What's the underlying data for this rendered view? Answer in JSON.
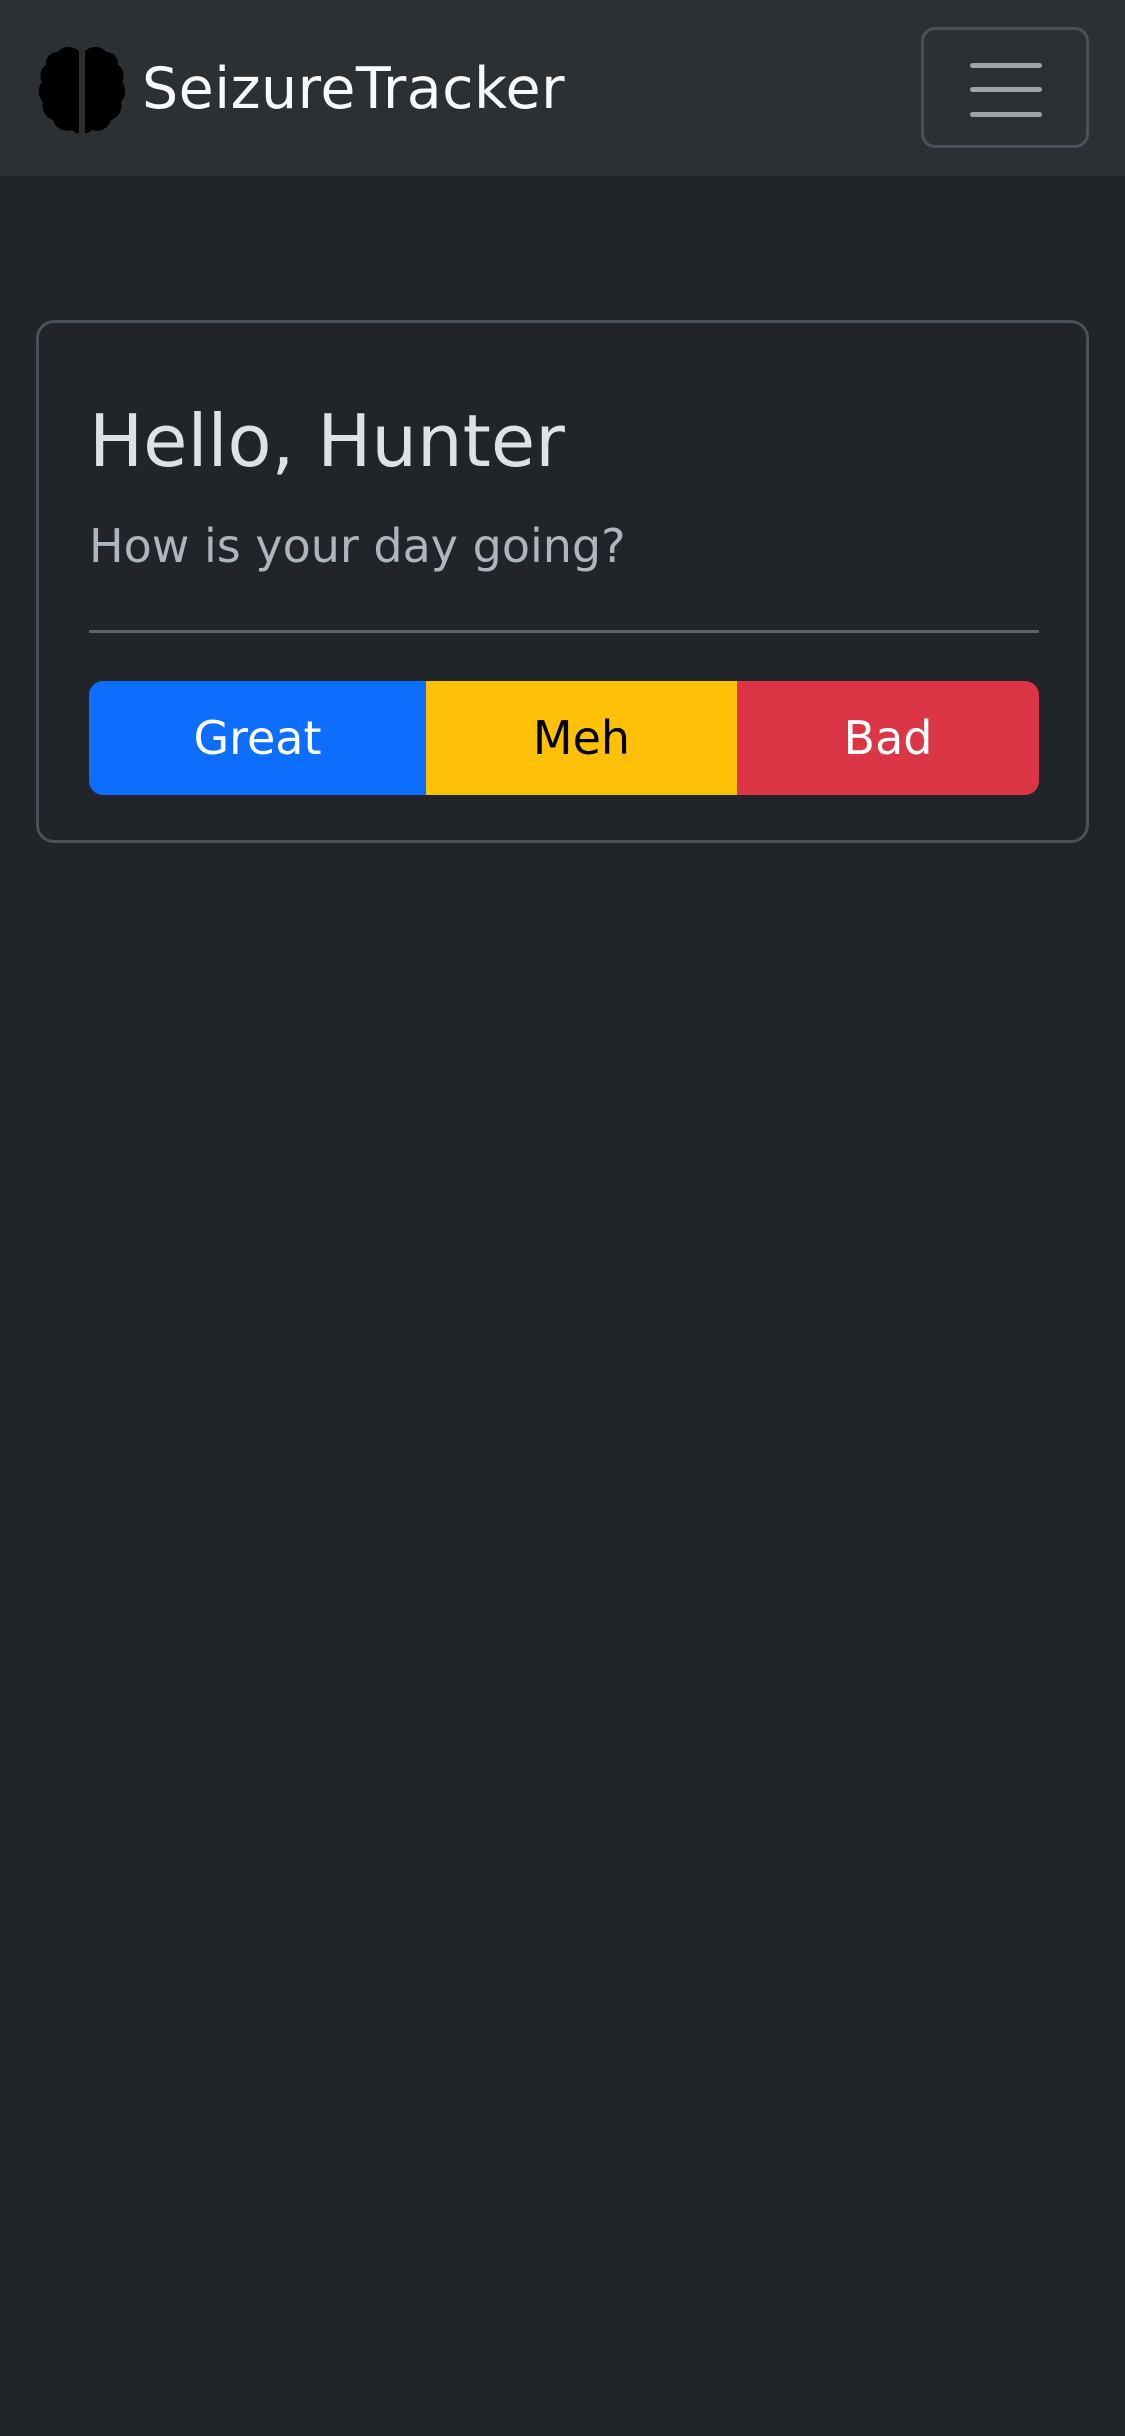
{
  "app": {
    "brand_name": "SeizureTracker",
    "brand_icon": "brain-icon"
  },
  "navbar": {
    "toggler_icon": "hamburger-menu-icon"
  },
  "greeting": {
    "title": "Hello, Hunter",
    "subtitle": "How is your day going?"
  },
  "mood_buttons": {
    "great": "Great",
    "meh": "Meh",
    "bad": "Bad"
  },
  "colors": {
    "background": "#212529",
    "navbar": "#2b3035",
    "great": "#0d6efd",
    "meh": "#ffc107",
    "bad": "#dc3545"
  }
}
